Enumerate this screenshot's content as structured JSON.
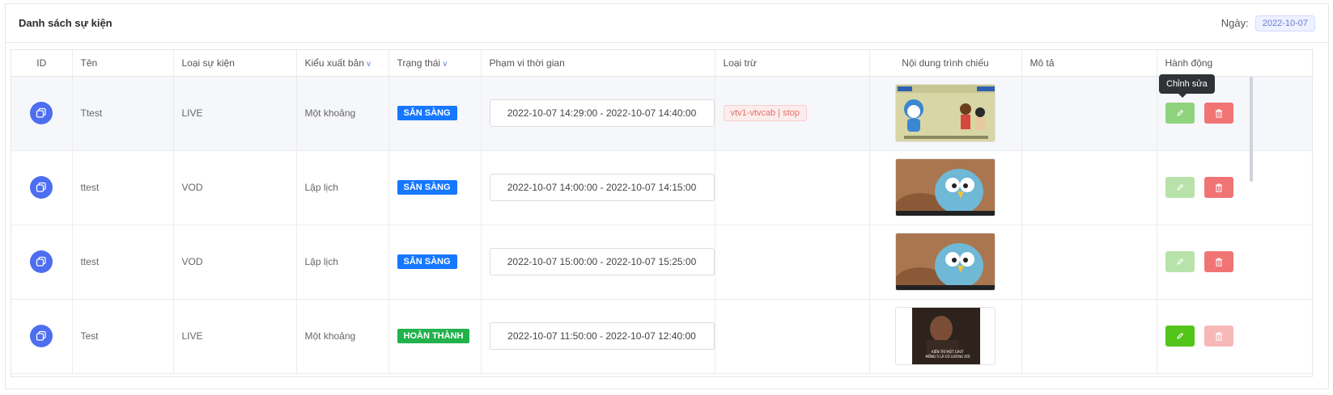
{
  "header": {
    "title": "Danh sách sự kiện",
    "date_label": "Ngày:",
    "date_value": "2022-10-07"
  },
  "table": {
    "columns": [
      "ID",
      "Tên",
      "Loại sự kiện",
      "Kiểu xuất bản",
      "Trạng thái",
      "Phạm vi thời gian",
      "Loại trừ",
      "Nội dung trình chiếu",
      "Mô tả",
      "Hành động"
    ],
    "rows": [
      {
        "name": "Ttest",
        "type": "LIVE",
        "publish": "Một khoảng",
        "status": "SẴN SÀNG",
        "range": "2022-10-07 14:29:00 - 2022-10-07 14:40:00",
        "exclude": "vtv1-vtvcab | stop",
        "description": ""
      },
      {
        "name": "ttest",
        "type": "VOD",
        "publish": "Lập lịch",
        "status": "SẴN SÀNG",
        "range": "2022-10-07 14:00:00 - 2022-10-07 14:15:00",
        "exclude": "",
        "description": ""
      },
      {
        "name": "ttest",
        "type": "VOD",
        "publish": "Lập lịch",
        "status": "SẴN SÀNG",
        "range": "2022-10-07 15:00:00 - 2022-10-07 15:25:00",
        "exclude": "",
        "description": ""
      },
      {
        "name": "Test",
        "type": "LIVE",
        "publish": "Một khoảng",
        "status": "HOÀN THÀNH",
        "range": "2022-10-07 11:50:00 - 2022-10-07 12:40:00",
        "exclude": "",
        "description": ""
      }
    ]
  },
  "tooltip": "Chỉnh sửa",
  "thumb_caption": "KIẾN TRÍ MỘT CHÚT MỒNG 5 LÀ CÓ LƯƠNG RỒI",
  "colors": {
    "status_ready": "#1677ff",
    "status_done": "#22b24c",
    "edit": "#8fd37d",
    "edit_active": "#52c41a",
    "delete": "#f07474",
    "copy": "#4d6ef0"
  },
  "icons": {
    "copy": "copy-icon",
    "edit": "pencil-icon",
    "delete": "trash-icon",
    "sort": "chevron-down-icon"
  }
}
